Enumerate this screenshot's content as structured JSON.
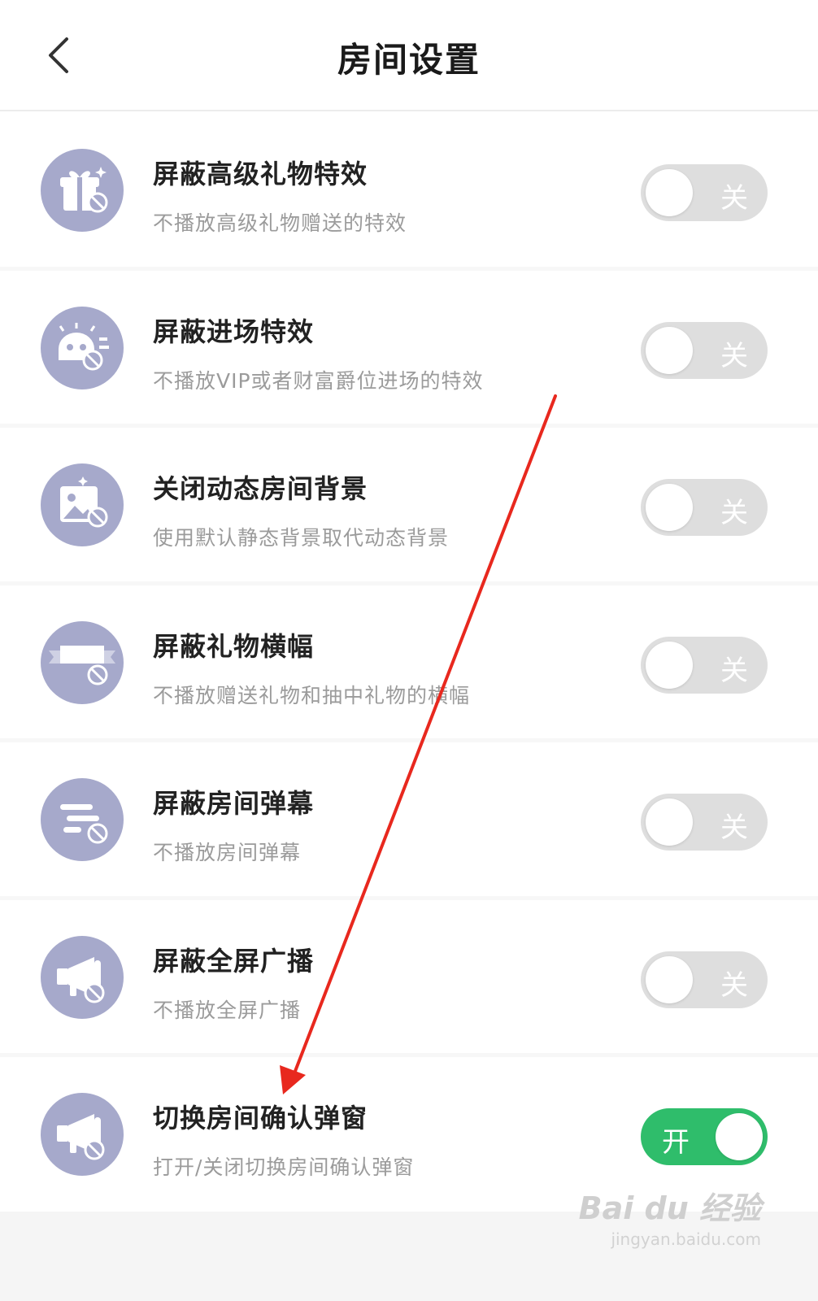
{
  "header": {
    "title": "房间设置",
    "back_icon": "chevron-left-icon"
  },
  "settings": [
    {
      "icon": "gift-blocked-icon",
      "title": "屏蔽高级礼物特效",
      "desc": "不播放高级礼物赠送的特效",
      "state": "off",
      "toggle_label": "关"
    },
    {
      "icon": "entrance-effect-blocked-icon",
      "title": "屏蔽进场特效",
      "desc": "不播放VIP或者财富爵位进场的特效",
      "state": "off",
      "toggle_label": "关"
    },
    {
      "icon": "image-blocked-icon",
      "title": "关闭动态房间背景",
      "desc": "使用默认静态背景取代动态背景",
      "state": "off",
      "toggle_label": "关"
    },
    {
      "icon": "banner-blocked-icon",
      "title": "屏蔽礼物横幅",
      "desc": "不播放赠送礼物和抽中礼物的横幅",
      "state": "off",
      "toggle_label": "关"
    },
    {
      "icon": "danmaku-blocked-icon",
      "title": "屏蔽房间弹幕",
      "desc": "不播放房间弹幕",
      "state": "off",
      "toggle_label": "关"
    },
    {
      "icon": "megaphone-blocked-icon",
      "title": "屏蔽全屏广播",
      "desc": "不播放全屏广播",
      "state": "off",
      "toggle_label": "关"
    },
    {
      "icon": "megaphone-blocked-icon",
      "title": "切换房间确认弹窗",
      "desc": "打开/关闭切换房间确认弹窗",
      "state": "on",
      "toggle_label": "开"
    }
  ],
  "watermark": {
    "text": "Bai du 经验",
    "sub": "jingyan.baidu.com"
  },
  "colors": {
    "toggle_on": "#2fbd6b",
    "toggle_off": "#dedede",
    "icon_bg": "#a6a9cb",
    "annotation_arrow": "#e8281e"
  }
}
